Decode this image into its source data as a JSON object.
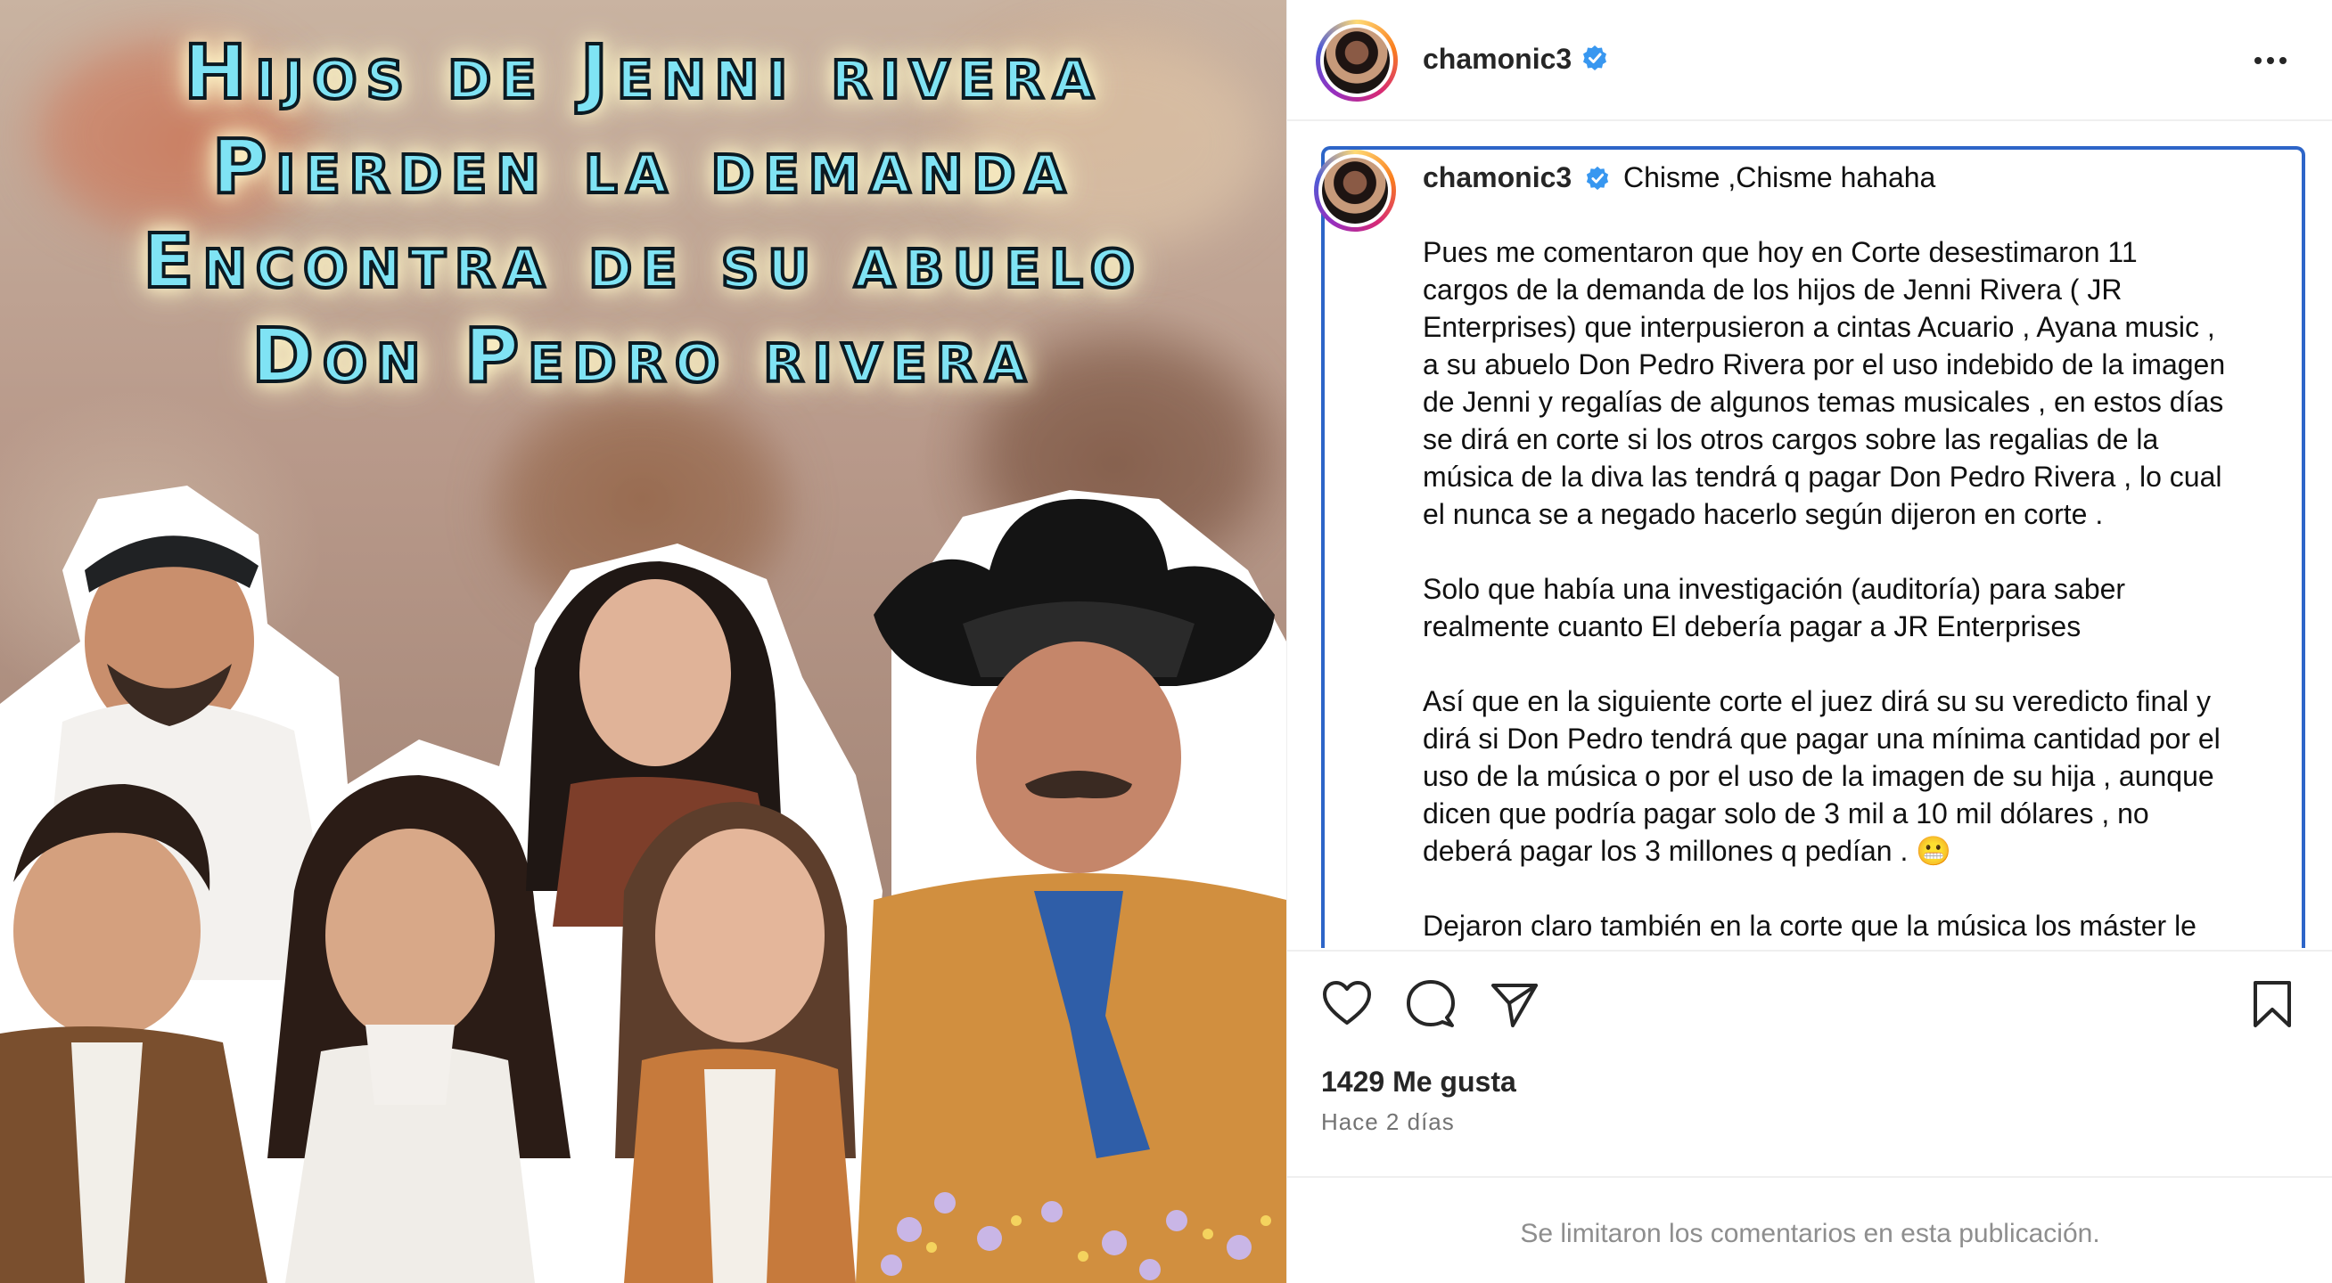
{
  "media": {
    "headline_lines": [
      "Hijos de Jenni rivera",
      "Pierden la demanda",
      "Encontra de su abuelo",
      "Don Pedro rivera"
    ]
  },
  "post": {
    "author": {
      "username": "chamonic3",
      "verified": true,
      "avatar": "avatar-photo"
    },
    "header_more_icon": "more-horizontal-icon",
    "caption": {
      "username": "chamonic3",
      "title": "Chisme ,Chisme hahaha",
      "paragraphs": [
        [
          "Pues me comentaron que hoy en Corte desestimaron 11",
          "cargos de la demanda de los hijos de Jenni Rivera ( JR",
          "Enterprises) que interpusieron a cintas Acuario , Ayana music ,",
          "a su abuelo Don Pedro Rivera por el uso indebido de la imagen",
          "de Jenni y regalías de algunos temas musicales , en estos días",
          "se dirá en corte si los otros cargos sobre las regalias de la",
          "música de la diva las tendrá q pagar Don Pedro Rivera , lo cual",
          "el nunca se a negado hacerlo según dijeron en corte ."
        ],
        [
          "Solo que había una investigación (auditoría) para saber",
          "realmente cuanto El debería pagar a JR Enterprises"
        ],
        [
          "Así que en la siguiente corte el juez dirá su su veredicto final y",
          "dirá si Don Pedro tendrá que pagar una mínima cantidad por el",
          "uso de la música o por el uso de la imagen de su hija , aunque",
          "dicen que podría pagar solo de 3 mil a 10 mil dólares , no",
          "deberá pagar los 3 millones q pedían . 😬"
        ],
        [
          "Dejaron claro también en la corte que la música los máster le"
        ]
      ]
    },
    "actions": {
      "like_icon": "heart-icon",
      "comment_icon": "comment-icon",
      "share_icon": "send-icon",
      "save_icon": "bookmark-icon"
    },
    "likes_text": "1429 Me gusta",
    "time_text": "Hace 2 días",
    "comments_notice": "Se limitaron los comentarios en esta publicación."
  },
  "colors": {
    "caption_border": "#2d65c8",
    "verified_badge": "#3897f0",
    "headline_fill": "#7fe3f4"
  }
}
